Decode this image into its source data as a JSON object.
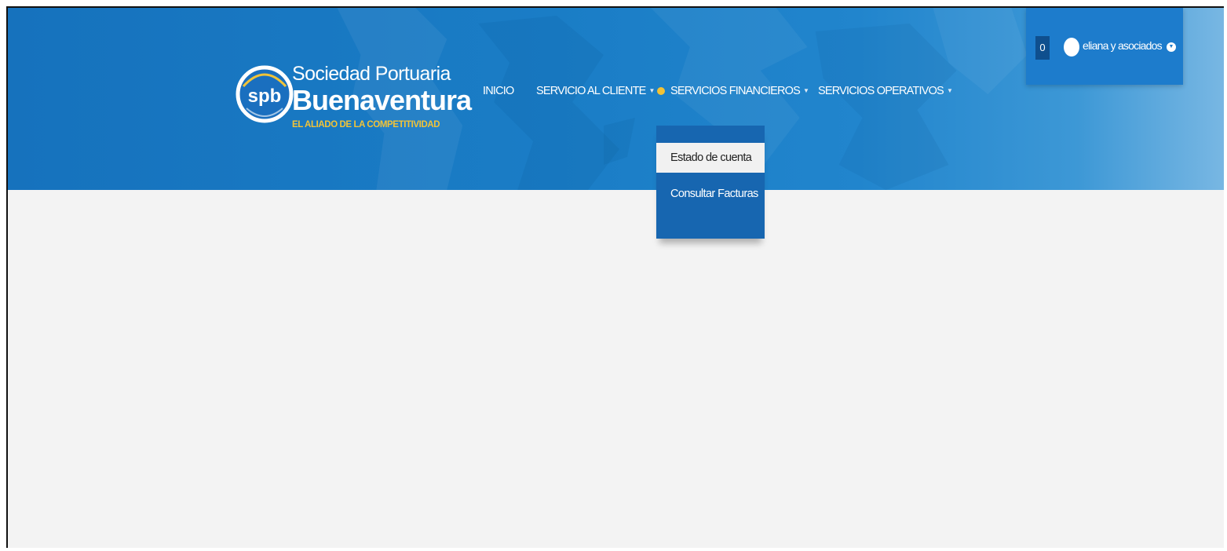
{
  "brand": {
    "name_line1": "Sociedad Portuaria",
    "name_line2": "Buenaventura",
    "tagline": "EL ALIADO DE LA COMPETITIVIDAD",
    "badge_text": "spb",
    "colors": {
      "header": "#1a7dc6",
      "tagline": "#f1c338",
      "dropdown": "#1766b0"
    }
  },
  "nav": {
    "items": [
      {
        "label": "INICIO"
      },
      {
        "label": "SERVICIO AL CLIENTE",
        "caret": "▼"
      },
      {
        "label": "SERVICIOS FINANCIEROS",
        "caret": "▼"
      },
      {
        "label": "SERVICIOS OPERATIVOS",
        "caret": "▼"
      }
    ]
  },
  "dropdown": {
    "items": [
      {
        "label": "Estado de cuenta"
      },
      {
        "label": "Consultar Facturas"
      }
    ]
  },
  "user": {
    "notification_count": "0",
    "name": "eliana y asociados",
    "caret_icon": "chevron-down-icon"
  }
}
